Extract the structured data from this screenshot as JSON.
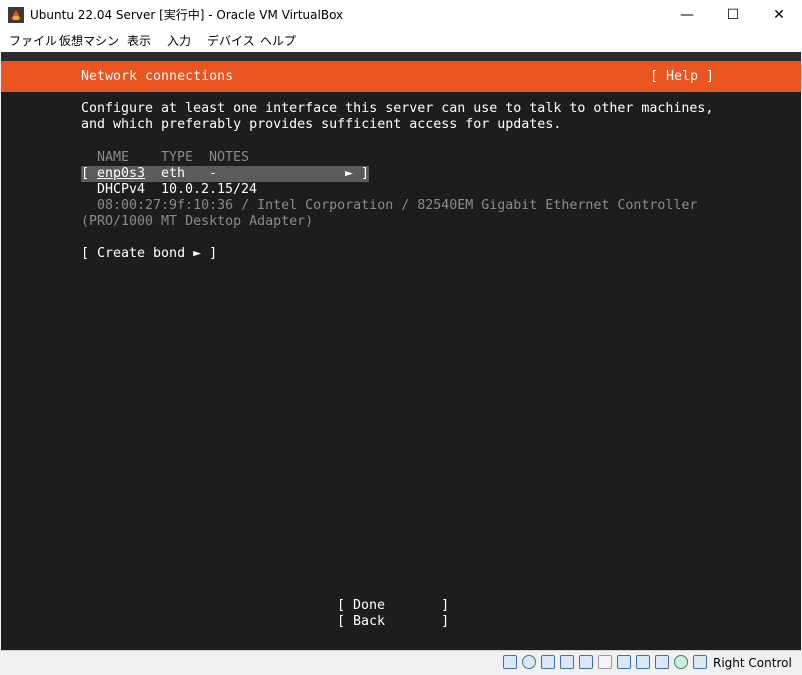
{
  "window": {
    "title": "Ubuntu 22.04 Server [実行中] - Oracle VM VirtualBox",
    "minimize_glyph": "—",
    "maximize_glyph": "☐",
    "close_glyph": "✕"
  },
  "menu": [
    "ファイル",
    "仮想マシン",
    "表示",
    "入力",
    "デバイス",
    "ヘルプ"
  ],
  "installer": {
    "header_title": "Network connections",
    "help_label": "[ Help ]",
    "intro_line1": "Configure at least one interface this server can use to talk to other machines,",
    "intro_line2": "and which preferably provides sufficient access for updates.",
    "table_headers": {
      "name": "NAME",
      "type": "TYPE",
      "notes": "NOTES"
    },
    "interface": {
      "open_bracket": "[",
      "name": "enp0s3",
      "type": "eth",
      "notes": "-",
      "arrow": "►",
      "close_bracket": "]",
      "method": "DHCPv4",
      "address": "10.0.2.15/24",
      "hw_line1": "08:00:27:9f:10:36 / Intel Corporation / 82540EM Gigabit Ethernet Controller",
      "hw_line2": "(PRO/1000 MT Desktop Adapter)"
    },
    "create_bond": "[ Create bond ► ]",
    "done_button": "[ Done       ]",
    "back_button": "[ Back       ]"
  },
  "statusbar": {
    "icons": [
      "hard-disk-icon",
      "optical-disk-icon",
      "audio-icon",
      "network-icon",
      "usb-icon",
      "shared-folders-icon",
      "display-icon",
      "video-capture-icon",
      "virtualization-icon",
      "mouse-integration-icon",
      "keyboard-icon"
    ],
    "host_key": "Right Control"
  }
}
